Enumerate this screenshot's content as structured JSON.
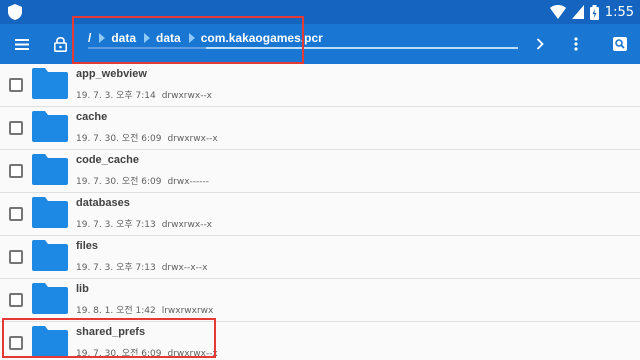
{
  "status_bar": {
    "time": "1:55",
    "icons": [
      "shield-icon",
      "wifi-icon",
      "signal-icon",
      "battery-icon"
    ]
  },
  "toolbar": {
    "icons": [
      "menu-icon",
      "lock-icon",
      "chevron-right-icon",
      "more-vert-icon",
      "search-icon"
    ]
  },
  "breadcrumb": {
    "root": "/",
    "items": [
      "data",
      "data",
      "com.kakaogames.pcr"
    ]
  },
  "files": [
    {
      "name": "app_webview",
      "date": "19. 7. 3. 오후 7:14",
      "perm": "drwxrwx--x"
    },
    {
      "name": "cache",
      "date": "19. 7. 30. 오전 6:09",
      "perm": "drwxrwx--x"
    },
    {
      "name": "code_cache",
      "date": "19. 7. 30. 오전 6:09",
      "perm": "drwx------"
    },
    {
      "name": "databases",
      "date": "19. 7. 3. 오후 7:13",
      "perm": "drwxrwx--x"
    },
    {
      "name": "files",
      "date": "19. 7. 3. 오후 7:13",
      "perm": "drwx--x--x"
    },
    {
      "name": "lib",
      "date": "19. 8. 1. 오전 1:42",
      "perm": "lrwxrwxrwx"
    },
    {
      "name": "shared_prefs",
      "date": "19. 7. 30. 오전 6:09",
      "perm": "drwxrwx--x"
    }
  ],
  "colors": {
    "statusbar": "#1565c0",
    "toolbar": "#1976d2",
    "folder": "#1e88e5",
    "highlight": "#e53935"
  }
}
